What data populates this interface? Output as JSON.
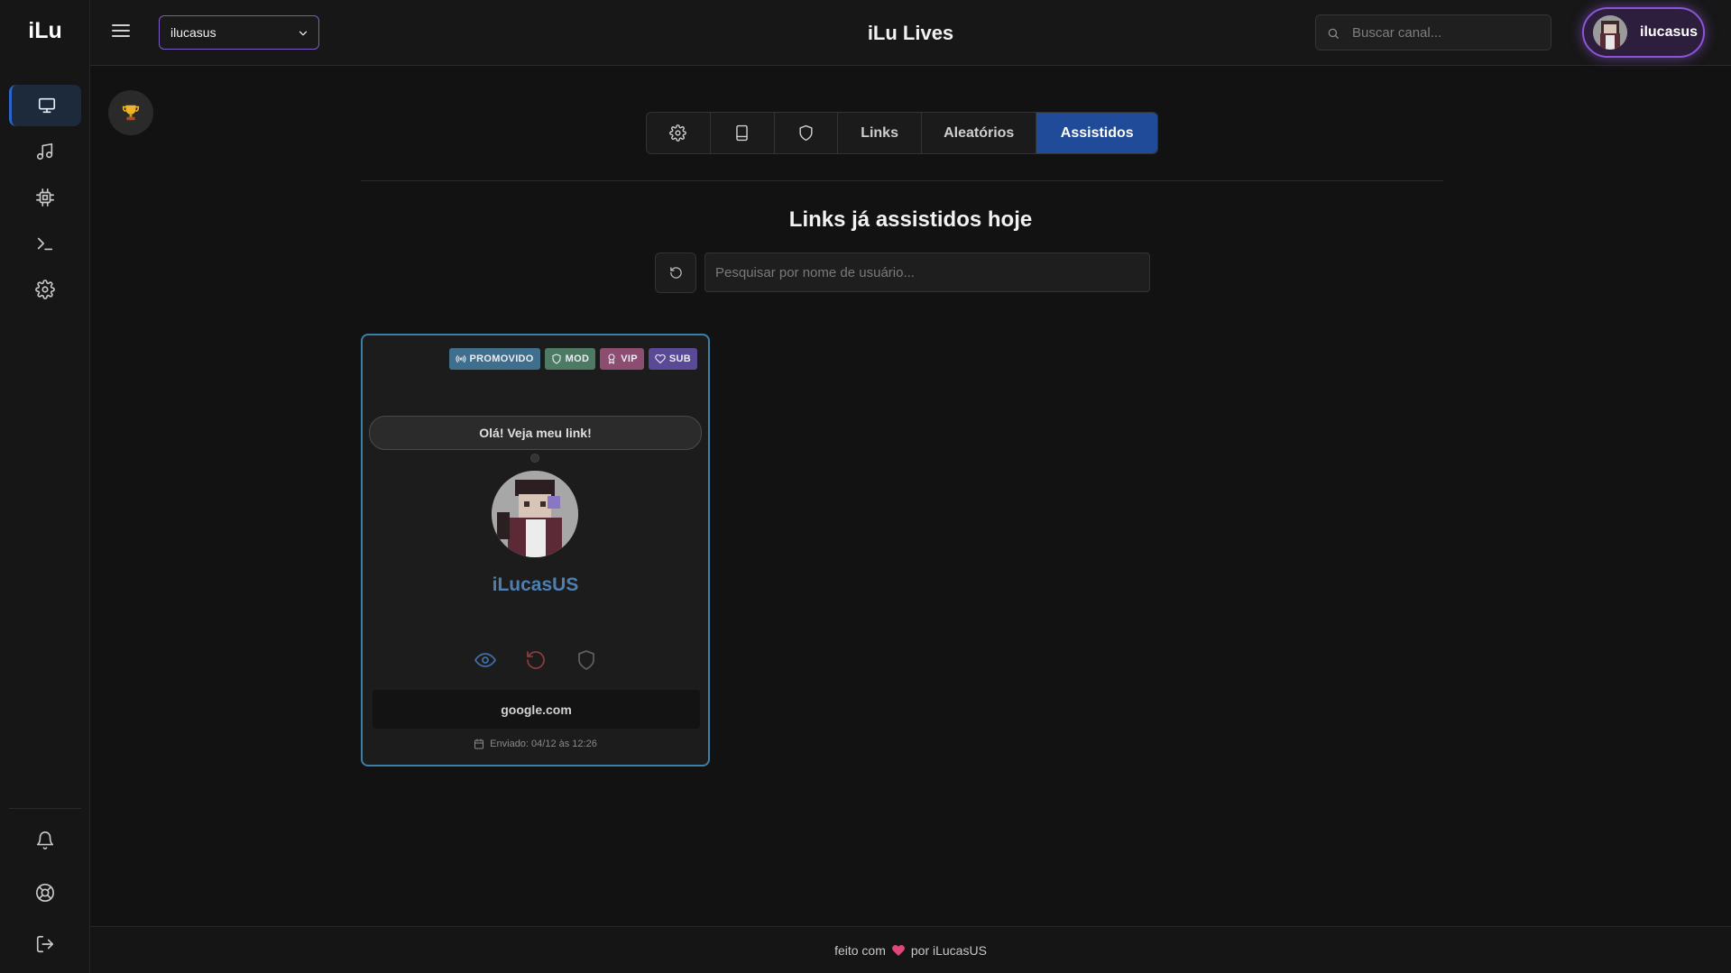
{
  "sidebar": {
    "logo": "iLu",
    "items": [
      {
        "name": "monitor-icon",
        "active": true
      },
      {
        "name": "music-icon",
        "active": false
      },
      {
        "name": "chip-icon",
        "active": false
      },
      {
        "name": "terminal-icon",
        "active": false
      },
      {
        "name": "gear-icon",
        "active": false
      }
    ],
    "bottom_items": [
      "bell-icon",
      "lifebuoy-icon",
      "logout-icon"
    ]
  },
  "header": {
    "channel_selected": "ilucasus",
    "title": "iLu Lives",
    "search_placeholder": "Buscar canal...",
    "user_name": "ilucasus"
  },
  "tabs": [
    {
      "icon": "gear-icon"
    },
    {
      "icon": "tablet-icon"
    },
    {
      "icon": "shield-icon"
    },
    {
      "label": "Links"
    },
    {
      "label": "Aleatórios"
    },
    {
      "label": "Assistidos",
      "active": true
    }
  ],
  "main": {
    "section_title": "Links já assistidos hoje",
    "user_search_placeholder": "Pesquisar por nome de usuário..."
  },
  "card": {
    "badges": [
      "PROMOVIDO",
      "MOD",
      "VIP",
      "SUB"
    ],
    "message": "Olá! Veja meu link!",
    "username": "iLucasUS",
    "link": "google.com",
    "sent": "Enviado: 04/12 às 12:26"
  },
  "footer": {
    "prefix": "feito com",
    "suffix": "por iLucasUS"
  },
  "colors": {
    "accent": "#1f4b98",
    "purple": "#8b55d6",
    "card_border": "#3d7fa8",
    "username": "#4d7fb0"
  }
}
